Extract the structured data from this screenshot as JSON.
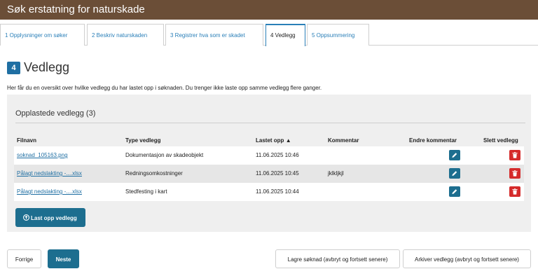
{
  "header": {
    "title": "Søk erstatning for naturskade"
  },
  "tabs": [
    {
      "label": "1  Opplysninger om søker"
    },
    {
      "label": "2  Beskriv naturskaden"
    },
    {
      "label": "3  Registrer hva som er skadet"
    },
    {
      "label": "4  Vedlegg"
    },
    {
      "label": "5  Oppsummering"
    }
  ],
  "section": {
    "step": "4",
    "title": "Vedlegg",
    "intro": "Her får du en oversikt over hvilke vedlegg du har lastet opp i søknaden. Du trenger ikke laste opp samme vedlegg flere ganger."
  },
  "panel": {
    "title": "Opplastede vedlegg (3)",
    "columns": {
      "filename": "Filnavn",
      "type": "Type vedlegg",
      "uploaded": "Lastet opp",
      "comment": "Kommentar",
      "edit_comment": "Endre kommentar",
      "delete": "Slett vedlegg"
    },
    "rows": [
      {
        "filename": "soknad_105163.png",
        "type": "Dokumentasjon av skadeobjekt",
        "uploaded": "11.06.2025 10:46",
        "comment": ""
      },
      {
        "filename": "Pålagt nedslakting -....xlsx",
        "type": "Redningsomkostninger",
        "uploaded": "11.06.2025 10:45",
        "comment": "jklkljkjl"
      },
      {
        "filename": "Pålagt nedslakting -....xlsx",
        "type": "Stedfesting i kart",
        "uploaded": "11.06.2025 10:44",
        "comment": ""
      }
    ],
    "upload_label": "Last opp vedlegg"
  },
  "footer": {
    "prev_label": "Forrige",
    "next_label": "Neste",
    "save_label": "Lagre søknad (avbryt og fortsett senere)",
    "archive_label": "Arkiver vedlegg (avbryt og fortsett senere)"
  },
  "colors": {
    "header_bg": "#6b4e37",
    "accent": "#1d6e8f",
    "danger": "#d52b2b",
    "panel_bg": "#efefef"
  }
}
